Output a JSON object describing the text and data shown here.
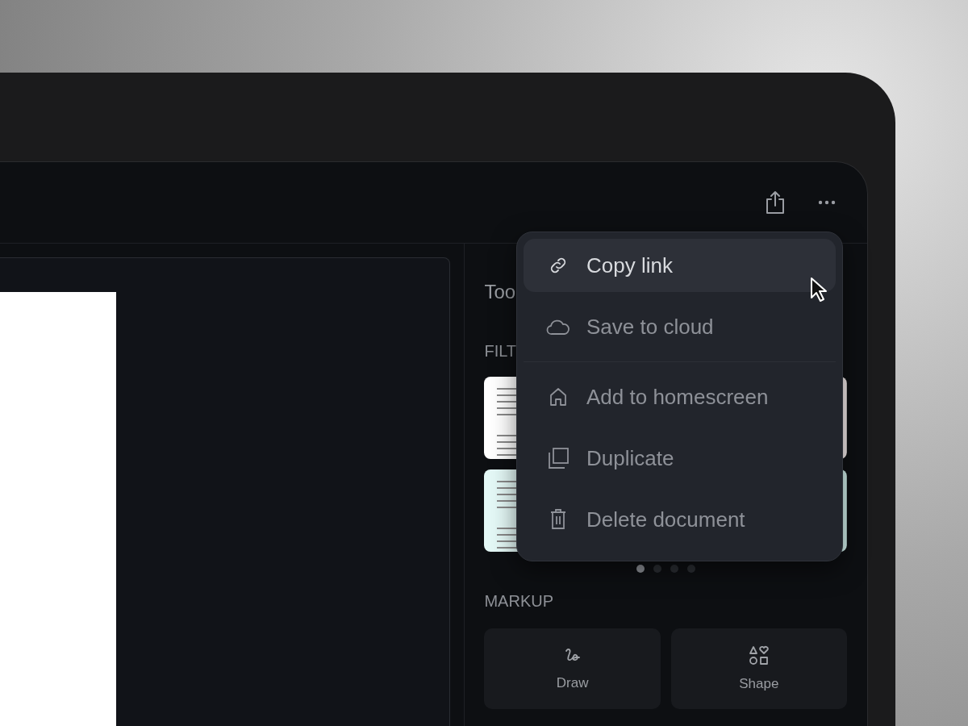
{
  "sidebar": {
    "title": "Too",
    "filters_heading": "FILT",
    "pager": [
      {
        "selected": true
      },
      {
        "selected": false
      },
      {
        "selected": false
      },
      {
        "selected": false
      }
    ],
    "markup_heading": "MARKUP",
    "tools": [
      {
        "kind": "draw",
        "label": "Draw"
      },
      {
        "kind": "shape",
        "label": "Shape"
      }
    ]
  },
  "menu": {
    "items": [
      {
        "kind": "link",
        "label": "Copy link",
        "selected": true,
        "separated": false
      },
      {
        "kind": "cloud",
        "label": "Save to cloud",
        "selected": false,
        "separated": false
      },
      {
        "kind": "home",
        "label": "Add to homescreen",
        "selected": false,
        "separated": true
      },
      {
        "kind": "duplicate",
        "label": "Duplicate",
        "selected": false,
        "separated": false
      },
      {
        "kind": "trash",
        "label": "Delete document",
        "selected": false,
        "separated": false
      }
    ]
  }
}
